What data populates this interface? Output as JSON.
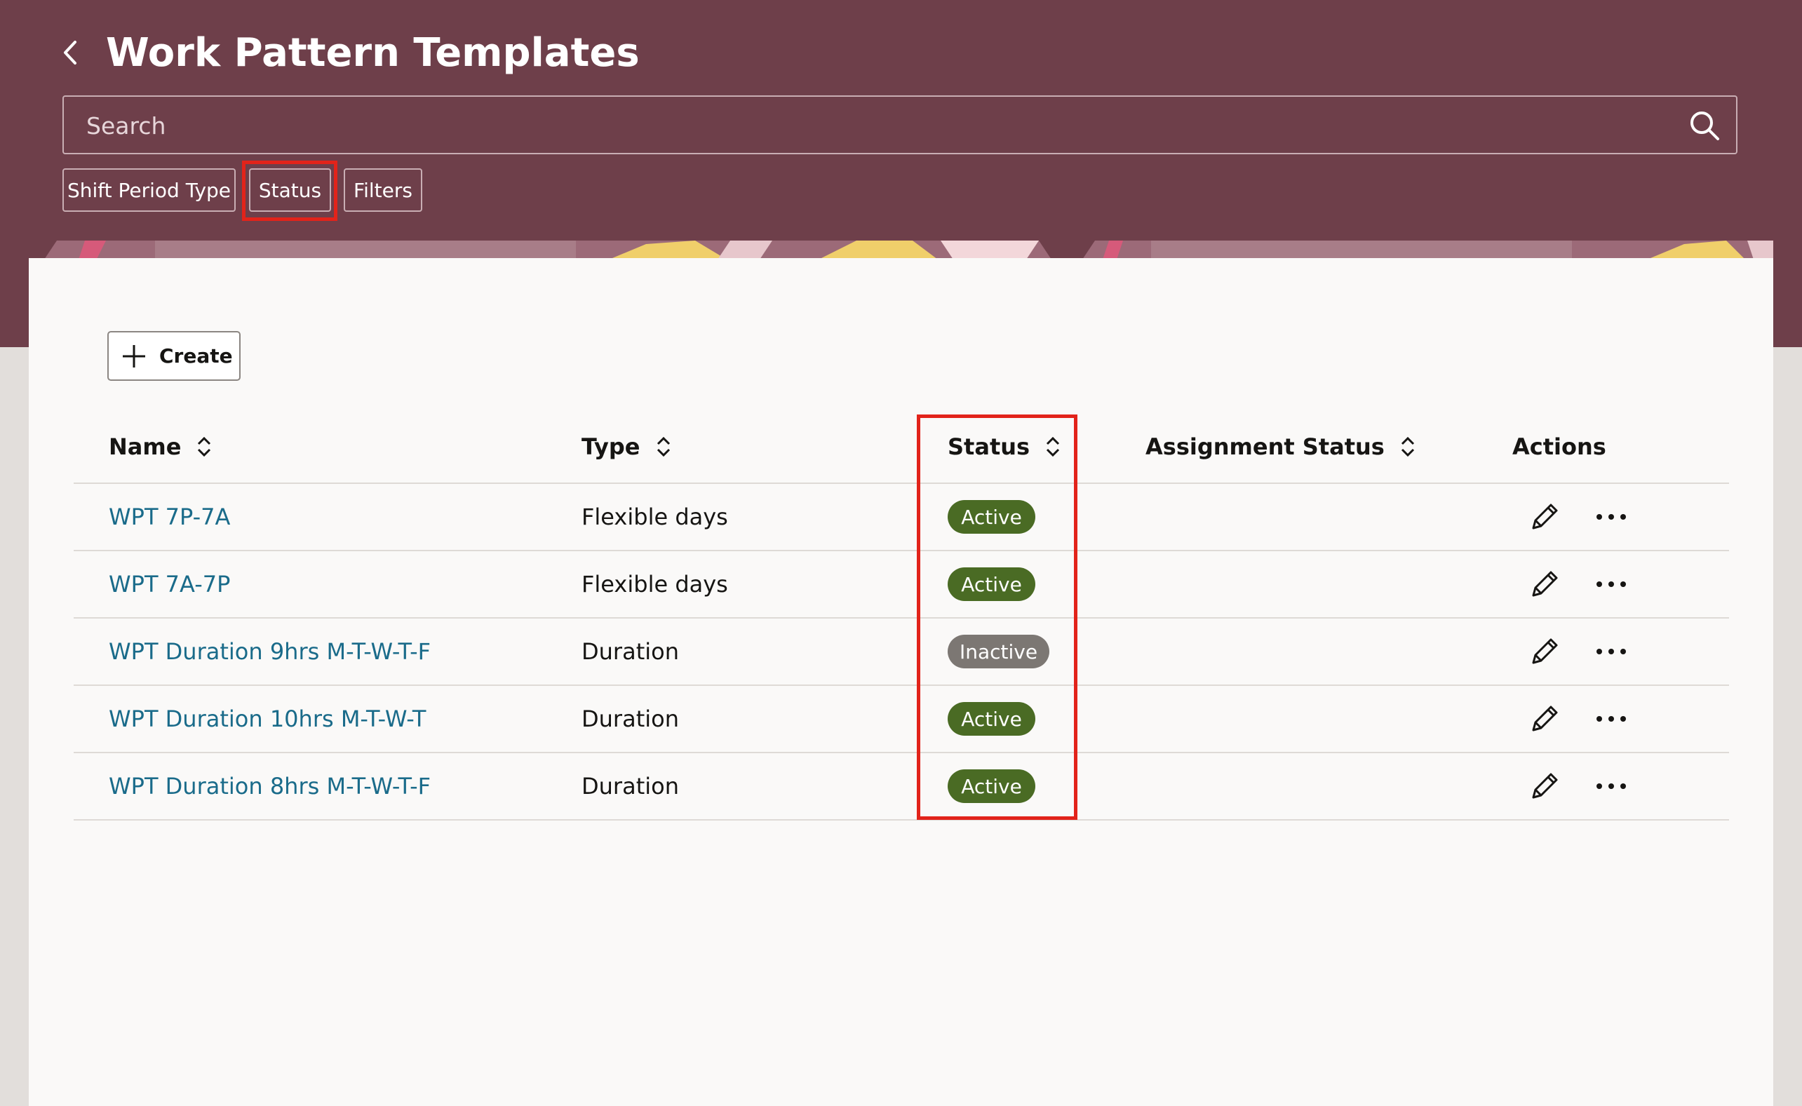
{
  "header": {
    "title": "Work Pattern Templates",
    "back_icon": "chevron-left-icon",
    "background_color": "#6e3f4a"
  },
  "search": {
    "placeholder": "Search",
    "value": "",
    "icon": "search-icon"
  },
  "filter_chips": [
    {
      "label": "Shift Period Type"
    },
    {
      "label": "Status",
      "highlighted": true
    },
    {
      "label": "Filters"
    }
  ],
  "toolbar": {
    "create_label": "Create",
    "create_icon": "plus-icon"
  },
  "table": {
    "columns": [
      {
        "label": "Name",
        "sortable": true
      },
      {
        "label": "Type",
        "sortable": true
      },
      {
        "label": "Status",
        "sortable": true,
        "highlighted": true
      },
      {
        "label": "Assignment Status",
        "sortable": true
      },
      {
        "label": "Actions",
        "sortable": false
      }
    ],
    "rows": [
      {
        "name": "WPT 7P-7A",
        "type": "Flexible days",
        "status": "Active",
        "assignment_status": ""
      },
      {
        "name": "WPT 7A-7P",
        "type": "Flexible days",
        "status": "Active",
        "assignment_status": ""
      },
      {
        "name": "WPT Duration 9hrs M-T-W-T-F",
        "type": "Duration",
        "status": "Inactive",
        "assignment_status": ""
      },
      {
        "name": "WPT Duration 10hrs M-T-W-T",
        "type": "Duration",
        "status": "Active",
        "assignment_status": ""
      },
      {
        "name": "WPT Duration 8hrs M-T-W-T-F",
        "type": "Duration",
        "status": "Active",
        "assignment_status": ""
      }
    ],
    "row_action_icons": [
      "pencil-icon",
      "more-horizontal-icon"
    ]
  },
  "colors": {
    "link": "#1a6b8a",
    "badge_active": "#4a6b24",
    "badge_inactive": "#7c7773",
    "highlight": "#e2231a"
  }
}
